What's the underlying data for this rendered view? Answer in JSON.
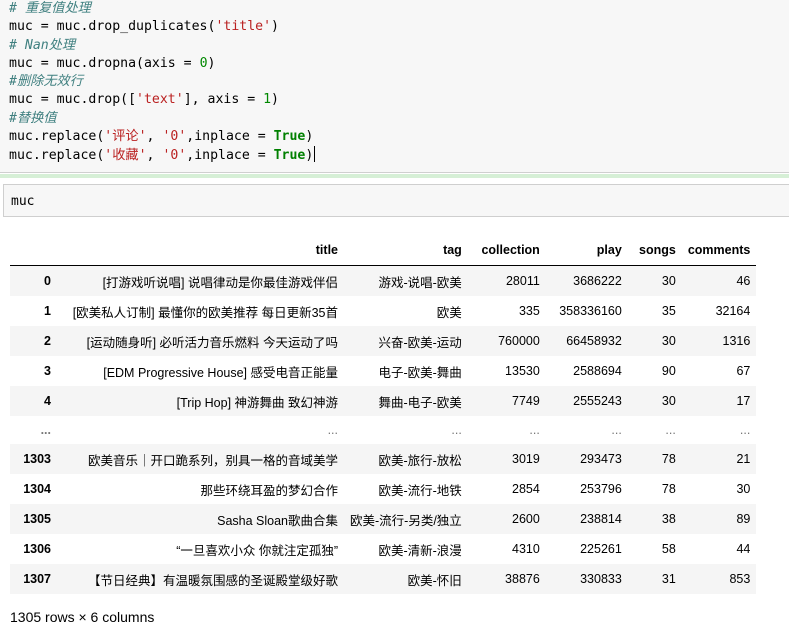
{
  "code_cell": {
    "lines": [
      "# 重复值处理",
      "muc = muc.drop_duplicates('title')",
      "# Nan处理",
      "muc = muc.dropna(axis = 0)",
      "#删除无效行",
      "muc = muc.drop(['text'], axis = 1)",
      "#替换值",
      "muc.replace('评论', '0',inplace = True)",
      "muc.replace('收藏', '0',inplace = True)"
    ]
  },
  "second_cell": {
    "code": "muc"
  },
  "dataframe": {
    "columns": [
      "title",
      "tag",
      "collection",
      "play",
      "songs",
      "comments"
    ],
    "rows": [
      {
        "index": "0",
        "cells": [
          "[打游戏听说唱] 说唱律动是你最佳游戏伴侣",
          "游戏-说唱-欧美",
          "28011",
          "3686222",
          "30",
          "46"
        ]
      },
      {
        "index": "1",
        "cells": [
          "[欧美私人订制] 最懂你的欧美推荐 每日更新35首",
          "欧美",
          "335",
          "358336160",
          "35",
          "32164"
        ]
      },
      {
        "index": "2",
        "cells": [
          "[运动随身听] 必听活力音乐燃料 今天运动了吗",
          "兴奋-欧美-运动",
          "760000",
          "66458932",
          "30",
          "1316"
        ]
      },
      {
        "index": "3",
        "cells": [
          "[EDM Progressive House] 感受电音正能量",
          "电子-欧美-舞曲",
          "13530",
          "2588694",
          "90",
          "67"
        ]
      },
      {
        "index": "4",
        "cells": [
          "[Trip Hop] 神游舞曲 致幻神游",
          "舞曲-电子-欧美",
          "7749",
          "2555243",
          "30",
          "17"
        ]
      },
      {
        "index": "...",
        "cells": [
          "...",
          "...",
          "...",
          "...",
          "...",
          "..."
        ]
      },
      {
        "index": "1303",
        "cells": [
          "欧美音乐｜开口跪系列，别具一格的音域美学",
          "欧美-旅行-放松",
          "3019",
          "293473",
          "78",
          "21"
        ]
      },
      {
        "index": "1304",
        "cells": [
          "那些环绕耳盈的梦幻合作",
          "欧美-流行-地铁",
          "2854",
          "253796",
          "78",
          "30"
        ]
      },
      {
        "index": "1305",
        "cells": [
          "Sasha Sloan歌曲合集",
          "欧美-流行-另类/独立",
          "2600",
          "238814",
          "38",
          "89"
        ]
      },
      {
        "index": "1306",
        "cells": [
          "“一旦喜欢小众 你就注定孤独”",
          "欧美-清新-浪漫",
          "4310",
          "225261",
          "58",
          "44"
        ]
      },
      {
        "index": "1307",
        "cells": [
          "【节日经典】有温暖氛围感的圣诞殿堂级好歌",
          "欧美-怀旧",
          "38876",
          "330833",
          "31",
          "853"
        ]
      }
    ]
  },
  "footer": {
    "shape": "1305 rows × 6 columns"
  }
}
